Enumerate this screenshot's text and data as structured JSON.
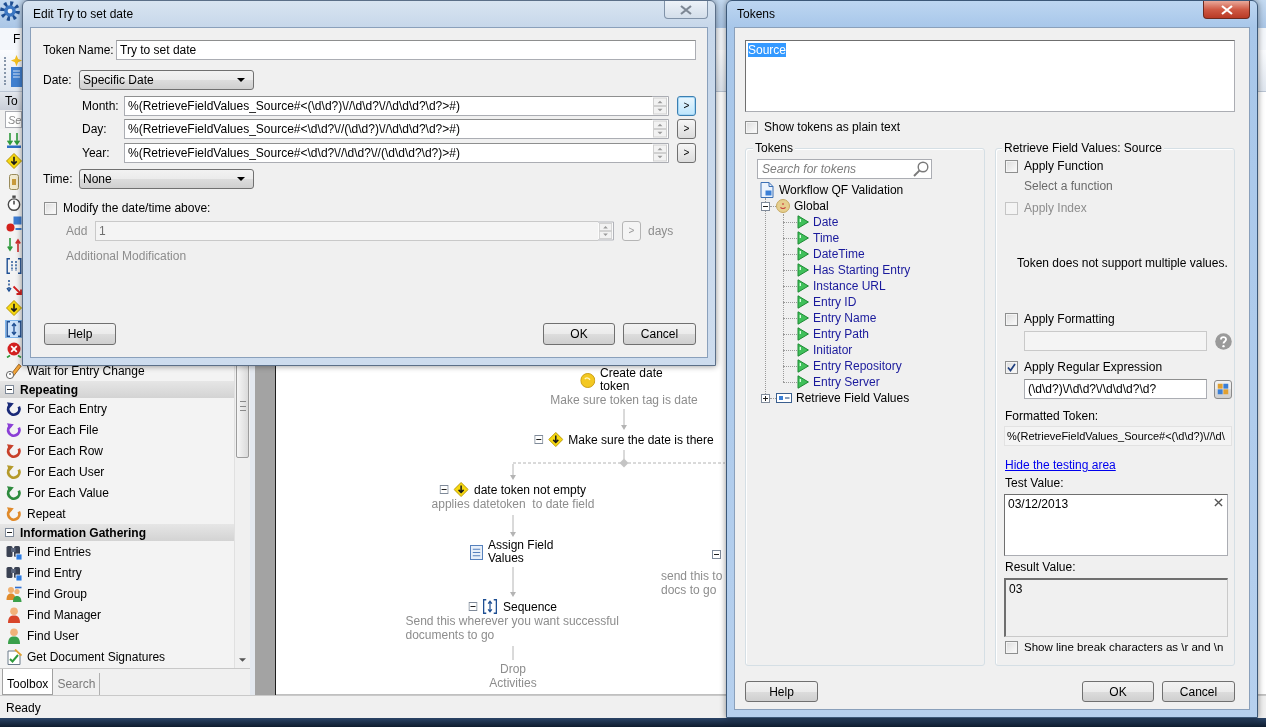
{
  "app": {
    "menu": [
      "F"
    ],
    "status": "Ready"
  },
  "toolbox": {
    "title": "To",
    "search_placeholder": "Se",
    "rows": [
      {
        "kind": "item",
        "selected": false
      },
      {
        "kind": "item",
        "selected": false
      },
      {
        "kind": "item",
        "selected": false
      },
      {
        "kind": "item",
        "selected": false
      },
      {
        "kind": "item",
        "selected": false
      },
      {
        "kind": "item",
        "selected": false
      },
      {
        "kind": "item",
        "selected": false
      },
      {
        "kind": "item",
        "selected": false
      },
      {
        "kind": "item",
        "selected": false
      },
      {
        "kind": "item",
        "selected": true
      },
      {
        "kind": "item",
        "selected": false
      },
      {
        "kind": "item",
        "label": "Wait for Entry Change",
        "selected": false
      },
      {
        "kind": "category",
        "label": "Repeating",
        "expanded": true
      },
      {
        "kind": "item",
        "label": "For Each Entry",
        "selected": false
      },
      {
        "kind": "item",
        "label": "For Each File",
        "selected": false
      },
      {
        "kind": "item",
        "label": "For Each Row",
        "selected": false
      },
      {
        "kind": "item",
        "label": "For Each User",
        "selected": false
      },
      {
        "kind": "item",
        "label": "For Each Value",
        "selected": false
      },
      {
        "kind": "item",
        "label": "Repeat",
        "selected": false
      },
      {
        "kind": "category",
        "label": "Information Gathering",
        "expanded": true
      },
      {
        "kind": "item",
        "label": "Find Entries",
        "selected": false
      },
      {
        "kind": "item",
        "label": "Find Entry",
        "selected": false
      },
      {
        "kind": "item",
        "label": "Find Group",
        "selected": false
      },
      {
        "kind": "item",
        "label": "Find Manager",
        "selected": false
      },
      {
        "kind": "item",
        "label": "Find User",
        "selected": false
      },
      {
        "kind": "item",
        "label": "Get Document Signatures",
        "selected": false
      }
    ],
    "tabs": [
      {
        "label": "Toolbox",
        "selected": true
      },
      {
        "label": "Search",
        "selected": false
      }
    ]
  },
  "workflow": {
    "nodes": [
      {
        "kind": "token",
        "title": "Create date token",
        "description": "Make sure token tag is date"
      },
      {
        "kind": "condition",
        "title": "Make sure the date is there",
        "expanded": true
      },
      {
        "kind": "branch",
        "title": "date token not empty",
        "description": "applies datetoken  to date field",
        "expanded": true
      },
      {
        "kind": "assign",
        "title": "Assign Field Values"
      },
      {
        "kind": "sequence",
        "title": "Sequence",
        "description": "Send this wherever you want successful documents to go",
        "expanded": true
      },
      {
        "kind": "drop",
        "title": "Drop Activities"
      },
      {
        "kind": "clipped_branch",
        "description_lines": [
          "send this to",
          "docs to go"
        ],
        "expanded": true
      }
    ]
  },
  "edit_dialog": {
    "title": "Edit Try to set date",
    "active": false,
    "token_name": {
      "label": "Token Name:",
      "value": "Try to set date"
    },
    "date": {
      "label": "Date:",
      "value": "Specific Date"
    },
    "parts": [
      {
        "label": "Month:",
        "value": "%(RetrieveFieldValues_Source#<(\\d\\d?)\\//\\d\\d?\\//\\d\\d\\d?\\d?>#)",
        "button": ">",
        "focused": true
      },
      {
        "label": "Day:",
        "value": "%(RetrieveFieldValues_Source#<\\d\\d?\\//(\\d\\d?)\\//\\d\\d\\d?\\d?>#)",
        "button": ">",
        "focused": false
      },
      {
        "label": "Year:",
        "value": "%(RetrieveFieldValues_Source#<\\d\\d?\\//\\d\\d?\\//(\\d\\d\\d?\\d?)>#)",
        "button": ">",
        "focused": false
      }
    ],
    "time": {
      "label": "Time:",
      "value": "None"
    },
    "modify": {
      "label": "Modify the date/time above:",
      "checked": false
    },
    "add": {
      "label": "Add",
      "value": "1",
      "button": ">",
      "unit": "days",
      "more": "Additional Modification"
    },
    "buttons": {
      "help": "Help",
      "ok": "OK",
      "cancel": "Cancel"
    }
  },
  "tokens_dialog": {
    "title": "Tokens",
    "active": true,
    "expression": {
      "text": "Source",
      "selected": true
    },
    "plain_text": {
      "label": "Show tokens as plain text",
      "checked": false
    },
    "tree_panel": {
      "title": "Tokens",
      "search_placeholder": "Search for tokens",
      "tree": [
        {
          "kind": "workflow",
          "label": "Workflow QF Validation",
          "children": [
            {
              "kind": "global",
              "label": "Global",
              "expanded": true,
              "children": [
                {
                  "kind": "token",
                  "label": "Date"
                },
                {
                  "kind": "token",
                  "label": "Time"
                },
                {
                  "kind": "token",
                  "label": "DateTime"
                },
                {
                  "kind": "token",
                  "label": "Has Starting Entry"
                },
                {
                  "kind": "token",
                  "label": "Instance URL"
                },
                {
                  "kind": "token",
                  "label": "Entry ID"
                },
                {
                  "kind": "token",
                  "label": "Entry Name"
                },
                {
                  "kind": "token",
                  "label": "Entry Path"
                },
                {
                  "kind": "token",
                  "label": "Initiator"
                },
                {
                  "kind": "token",
                  "label": "Entry Repository"
                },
                {
                  "kind": "token",
                  "label": "Entry Server"
                }
              ]
            },
            {
              "kind": "activity",
              "label": "Retrieve Field Values",
              "expanded": false
            }
          ]
        }
      ]
    },
    "details": {
      "title": "Retrieve Field Values: Source",
      "function": {
        "label": "Apply Function",
        "checked": false,
        "hint": "Select a function"
      },
      "index": {
        "label": "Apply Index",
        "checked": false,
        "disabled": true
      },
      "note": "Token does not support multiple values.",
      "formatting": {
        "label": "Apply Formatting",
        "checked": false
      },
      "regex": {
        "label": "Apply Regular Expression",
        "checked": true,
        "value": "(\\d\\d?)\\/\\d\\d?\\/\\d\\d\\d?\\d?"
      },
      "formatted": {
        "label": "Formatted Token:",
        "value": "%(RetrieveFieldValues_Source#<(\\d\\d?)\\//\\d\\"
      },
      "testing_link": "Hide the testing area",
      "test": {
        "label": "Test Value:",
        "value": "03/12/2013"
      },
      "result": {
        "label": "Result Value:",
        "value": "03"
      },
      "line_breaks": {
        "label": "Show line break characters as \\r and \\n",
        "checked": false
      }
    },
    "buttons": {
      "help": "Help",
      "ok": "OK",
      "cancel": "Cancel"
    }
  }
}
